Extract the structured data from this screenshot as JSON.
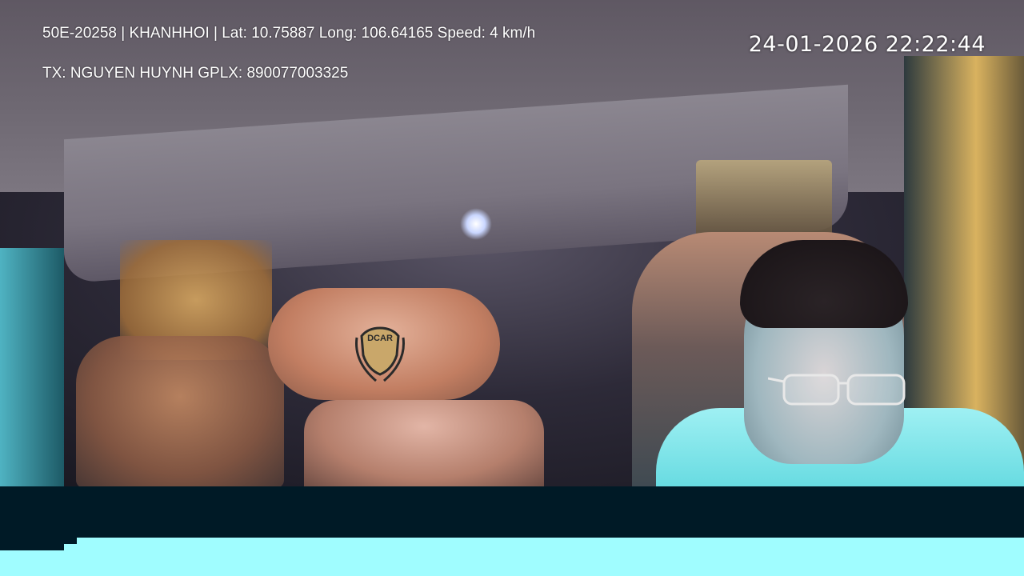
{
  "overlay": {
    "line1": "50E-20258 | KHANHHOI | Lat: 10.75887 Long: 106.64165 Speed: 4 km/h",
    "line2": "TX: NGUYEN HUYNH GPLX: 890077003325",
    "timestamp": "24-01-2026 22:22:44"
  },
  "scene": {
    "headrest_logo_text": "DCAR",
    "seat_badge_text": "DCAR"
  }
}
